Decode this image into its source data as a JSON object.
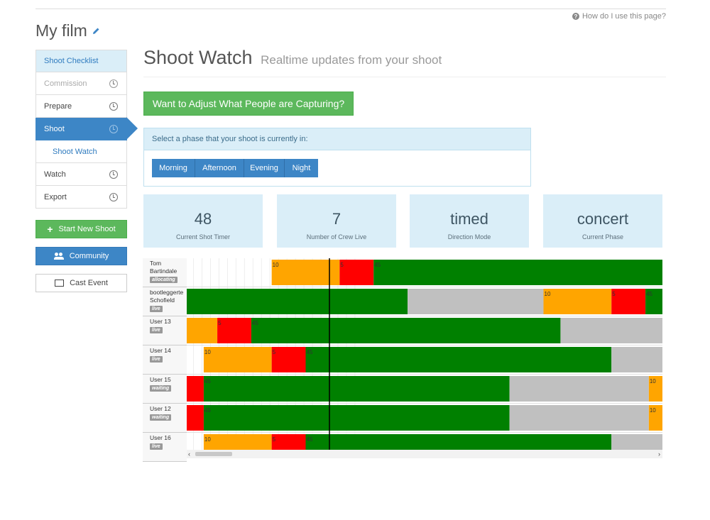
{
  "help": {
    "label": "How do I use this page?"
  },
  "film": {
    "title": "My film"
  },
  "sidebar": {
    "items": [
      {
        "label": "Shoot Checklist",
        "state": "head"
      },
      {
        "label": "Commission",
        "state": "disabled",
        "icon": "clock-icon"
      },
      {
        "label": "Prepare",
        "state": "normal",
        "icon": "clock-icon"
      },
      {
        "label": "Shoot",
        "state": "active",
        "icon": "clock-icon"
      },
      {
        "label": "Shoot Watch",
        "state": "sub"
      },
      {
        "label": "Watch",
        "state": "normal",
        "icon": "clock-icon"
      },
      {
        "label": "Export",
        "state": "normal",
        "icon": "clock-icon"
      }
    ],
    "start_new_shoot": "Start New Shoot",
    "community": "Community",
    "cast_event": "Cast Event"
  },
  "page": {
    "title": "Shoot Watch",
    "subtitle": "Realtime updates from your shoot"
  },
  "adjust_button": "Want to Adjust What People are Capturing?",
  "phase": {
    "prompt": "Select a phase that your shoot is currently in:",
    "options": [
      "Morning",
      "Afternoon",
      "Evening",
      "Night"
    ]
  },
  "stats": [
    {
      "value": "48",
      "label": "Current Shot Timer"
    },
    {
      "value": "7",
      "label": "Number of Crew Live"
    },
    {
      "value": "timed",
      "label": "Direction Mode"
    },
    {
      "value": "concert",
      "label": "Current Phase"
    }
  ],
  "colors": {
    "orange": "#ffa500",
    "red": "#ff0000",
    "green": "#008000",
    "grey": "#c0c0c0",
    "accent": "#3d86c6",
    "success": "#5cb85c"
  },
  "timeline": {
    "time_unit": "seconds",
    "current_time": 42,
    "visible_range": [
      0,
      140
    ],
    "rows": [
      {
        "name": [
          "Tom",
          "Bartindale"
        ],
        "status": "allocating",
        "segments": [
          {
            "start": 25,
            "end": 45,
            "kind": "orange",
            "label": "10"
          },
          {
            "start": 45,
            "end": 55,
            "kind": "red",
            "label": "5"
          },
          {
            "start": 55,
            "end": 140,
            "kind": "green",
            "label": "45"
          }
        ]
      },
      {
        "name": [
          "bootleggerte",
          "Schofield"
        ],
        "status": "live",
        "segments": [
          {
            "start": 0,
            "end": 65,
            "kind": "green",
            "label": ""
          },
          {
            "start": 65,
            "end": 105,
            "kind": "grey",
            "label": ""
          },
          {
            "start": 105,
            "end": 125,
            "kind": "orange",
            "label": "10"
          },
          {
            "start": 125,
            "end": 135,
            "kind": "red",
            "label": "5"
          },
          {
            "start": 135,
            "end": 140,
            "kind": "green",
            "label": "45"
          }
        ]
      },
      {
        "name": [
          "User 13"
        ],
        "status": "live",
        "segments": [
          {
            "start": 0,
            "end": 9,
            "kind": "orange",
            "label": ""
          },
          {
            "start": 9,
            "end": 19,
            "kind": "red",
            "label": "5"
          },
          {
            "start": 19,
            "end": 110,
            "kind": "green",
            "label": "45"
          },
          {
            "start": 110,
            "end": 140,
            "kind": "grey",
            "label": ""
          }
        ]
      },
      {
        "name": [
          "User 14"
        ],
        "status": "live",
        "segments": [
          {
            "start": 5,
            "end": 25,
            "kind": "orange",
            "label": "10"
          },
          {
            "start": 25,
            "end": 35,
            "kind": "red",
            "label": "5"
          },
          {
            "start": 35,
            "end": 125,
            "kind": "green",
            "label": "45"
          },
          {
            "start": 125,
            "end": 140,
            "kind": "grey",
            "label": ""
          }
        ]
      },
      {
        "name": [
          "User 15"
        ],
        "status": "waiting",
        "segments": [
          {
            "start": 0,
            "end": 5,
            "kind": "red",
            "label": ""
          },
          {
            "start": 5,
            "end": 95,
            "kind": "green",
            "label": "45"
          },
          {
            "start": 95,
            "end": 136,
            "kind": "grey",
            "label": ""
          },
          {
            "start": 136,
            "end": 140,
            "kind": "orange",
            "label": "10"
          }
        ]
      },
      {
        "name": [
          "User 12"
        ],
        "status": "waiting",
        "segments": [
          {
            "start": 0,
            "end": 5,
            "kind": "red",
            "label": ""
          },
          {
            "start": 5,
            "end": 95,
            "kind": "green",
            "label": "45"
          },
          {
            "start": 95,
            "end": 136,
            "kind": "grey",
            "label": ""
          },
          {
            "start": 136,
            "end": 140,
            "kind": "orange",
            "label": "10"
          }
        ]
      },
      {
        "name": [
          "User 16"
        ],
        "status": "live",
        "segments": [
          {
            "start": 5,
            "end": 25,
            "kind": "orange",
            "label": "10"
          },
          {
            "start": 25,
            "end": 35,
            "kind": "red",
            "label": "5"
          },
          {
            "start": 35,
            "end": 125,
            "kind": "green",
            "label": "45"
          },
          {
            "start": 125,
            "end": 140,
            "kind": "grey",
            "label": ""
          }
        ]
      }
    ]
  }
}
